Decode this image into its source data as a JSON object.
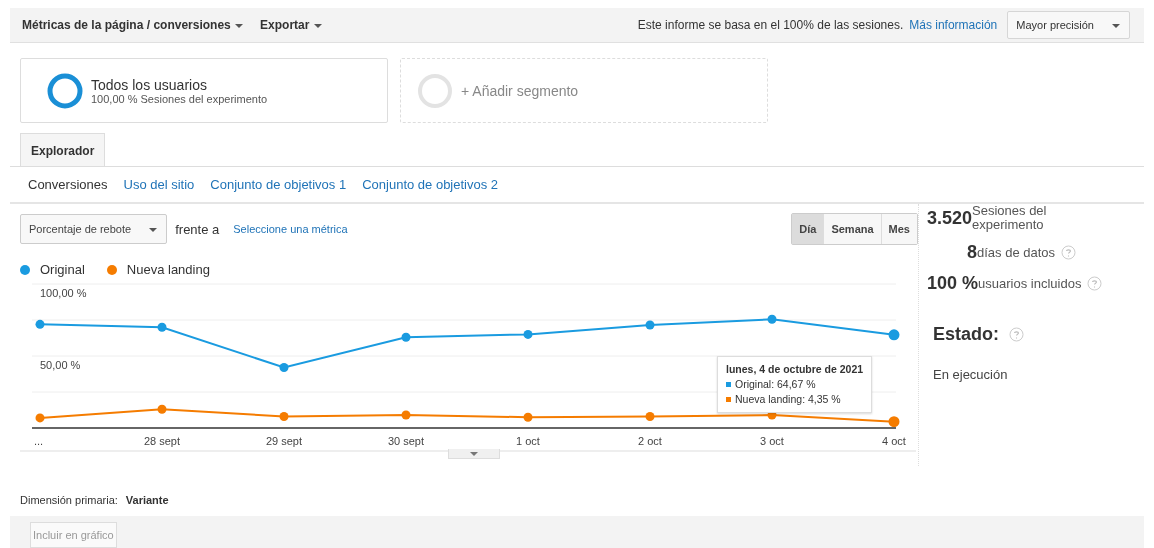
{
  "toolbar": {
    "menus": [
      "Métricas de la página / conversiones",
      "Exportar"
    ],
    "notice": "Este informe se basa en el 100% de las sesiones.",
    "notice_link": "Más información",
    "precision": "Mayor precisión"
  },
  "segments": [
    {
      "kind": "active",
      "name": "Todos los usuarios",
      "detail": "100,00 % Sesiones del experimento"
    },
    {
      "kind": "add",
      "name": "+ Añadir segmento"
    }
  ],
  "tabs": [
    {
      "label": "Explorador",
      "selected": true
    }
  ],
  "subtabs": [
    {
      "label": "Conversiones",
      "selected": true
    },
    {
      "label": "Uso del sitio",
      "selected": false
    },
    {
      "label": "Conjunto de objetivos 1",
      "selected": false
    },
    {
      "label": "Conjunto de objetivos 2",
      "selected": false
    }
  ],
  "metric": {
    "value": "Porcentaje de rebote",
    "versus": "frente a",
    "select_link": "Seleccione una métrica"
  },
  "periods": [
    {
      "label": "Día",
      "selected": true
    },
    {
      "label": "Semana",
      "selected": false
    },
    {
      "label": "Mes",
      "selected": false
    }
  ],
  "chart_data": {
    "type": "line",
    "categories": [
      "...",
      "28 sept",
      "29 sept",
      "30 sept",
      "1 oct",
      "2 oct",
      "3 oct",
      "4 oct"
    ],
    "series": [
      {
        "name": "Original",
        "color": "#1a9be0",
        "marker": true,
        "values": [
          72,
          70,
          42,
          63,
          65,
          71.5,
          75.5,
          64.7
        ]
      },
      {
        "name": "Nueva landing",
        "color": "#f57c00",
        "marker": true,
        "values": [
          7,
          13,
          8,
          9,
          7.5,
          8,
          9,
          4.4
        ]
      }
    ],
    "ylim": [
      0,
      100
    ],
    "yticks": [
      {
        "value": 50,
        "label": "50,00 %"
      },
      {
        "value": 100,
        "label": "100,00 %"
      }
    ]
  },
  "tooltip": {
    "title": "lunes, 4 de octubre de 2021",
    "rows": [
      {
        "text": "Original: 64,67 %",
        "color": "#1a9be0"
      },
      {
        "text": "Nueva landing: 4,35 %",
        "color": "#f57c00"
      }
    ]
  },
  "stats": [
    {
      "value": "3.520",
      "label": "Sesiones del experimento",
      "help": false
    },
    {
      "value": "8",
      "label": "días de datos",
      "help": true
    },
    {
      "value": "100 %",
      "label": "usuarios incluidos",
      "help": true
    }
  ],
  "status": {
    "title": "Estado:",
    "value": "En ejecución"
  },
  "dimension": {
    "label": "Dimensión primaria:",
    "value": "Variante"
  },
  "include_button": {
    "label": "Incluir en gráfico",
    "disabled": true
  }
}
